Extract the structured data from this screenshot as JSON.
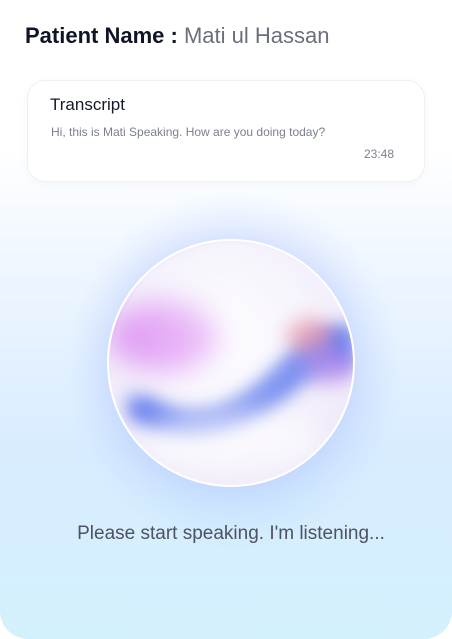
{
  "header": {
    "label": "Patient Name : ",
    "value": "Mati ul Hassan"
  },
  "transcript": {
    "title": "Transcript",
    "message": "Hi, this is Mati Speaking. How are you doing today?",
    "time": "23:48"
  },
  "status": {
    "text": "Please start speaking. I'm listening..."
  }
}
